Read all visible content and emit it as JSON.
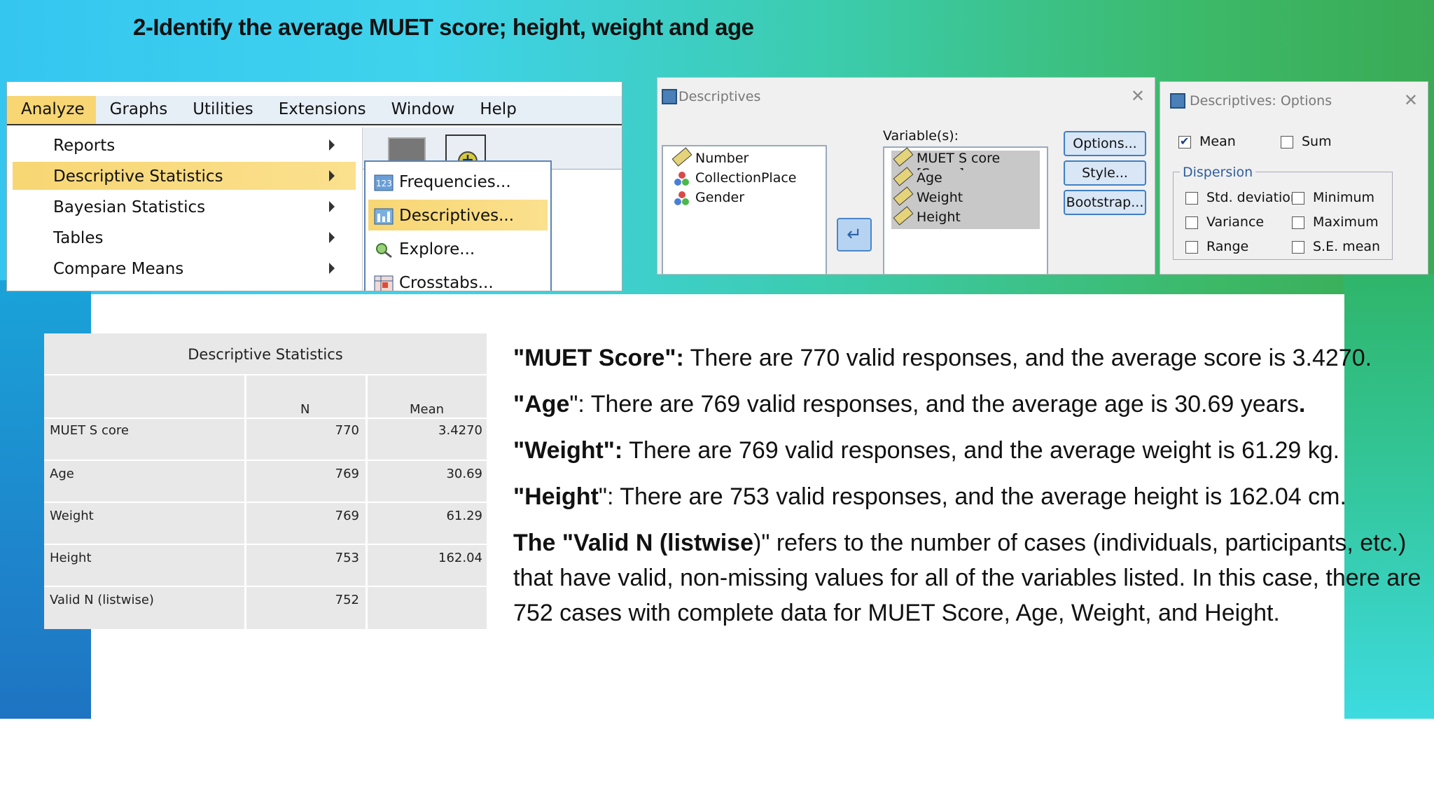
{
  "slide": {
    "title": "2-Identify the average MUET score; height, weight and age"
  },
  "menubar": {
    "items": [
      "Analyze",
      "Graphs",
      "Utilities",
      "Extensions",
      "Window",
      "Help"
    ],
    "active": "Analyze"
  },
  "analyze_menu": {
    "items": [
      "Reports",
      "Descriptive Statistics",
      "Bayesian Statistics",
      "Tables",
      "Compare Means"
    ],
    "active": "Descriptive Statistics"
  },
  "submenu": {
    "items": [
      "Frequencies...",
      "Descriptives...",
      "Explore...",
      "Crosstabs..."
    ],
    "active": "Descriptives..."
  },
  "descriptives_dialog": {
    "title": "Descriptives",
    "source_variables": [
      "Number",
      "CollectionPlace",
      "Gender"
    ],
    "variables_label": "Variable(s):",
    "selected_variables": [
      "MUET S core [Score]",
      "Age",
      "Weight",
      "Height"
    ],
    "buttons": [
      "Options...",
      "Style...",
      "Bootstrap..."
    ]
  },
  "options_dialog": {
    "title": "Descriptives: Options",
    "mean_label": "Mean",
    "mean_checked": true,
    "sum_label": "Sum",
    "sum_checked": false,
    "dispersion_label": "Dispersion",
    "dispersion_items": [
      "Std. deviation",
      "Minimum",
      "Variance",
      "Maximum",
      "Range",
      "S.E. mean"
    ]
  },
  "stats_table": {
    "title": "Descriptive Statistics",
    "col_n": "N",
    "col_mean": "Mean",
    "rows": [
      {
        "label": "MUET S core",
        "n": "770",
        "mean": "3.4270"
      },
      {
        "label": "Age",
        "n": "769",
        "mean": "30.69"
      },
      {
        "label": "Weight",
        "n": "769",
        "mean": "61.29"
      },
      {
        "label": "Height",
        "n": "753",
        "mean": "162.04"
      },
      {
        "label": "Valid N (listwise)",
        "n": "752",
        "mean": ""
      }
    ]
  },
  "description": {
    "p1_bold": "\"MUET Score\":",
    "p1_text": " There are 770 valid responses, and the average score is 3.4270.",
    "p2_bold": "\"Age",
    "p2_text": "\": There are 769 valid responses, and the average age is 30.69 years",
    "p2_end": ".",
    "p3_bold": "\"Weight\":",
    "p3_text": " There are 769 valid responses, and the average weight is 61.29 kg.",
    "p4_bold": "\"Height",
    "p4_text": "\": There are 753 valid responses, and the average height is 162.04 cm.",
    "p5_bold": "The \"Valid N (listwise",
    "p5_text": ")\" refers to the number of cases (individuals, participants, etc.) that have valid, non-missing values for all of the variables listed. In this case, there are 752 cases with complete data for MUET Score, Age, Weight, and Height."
  }
}
